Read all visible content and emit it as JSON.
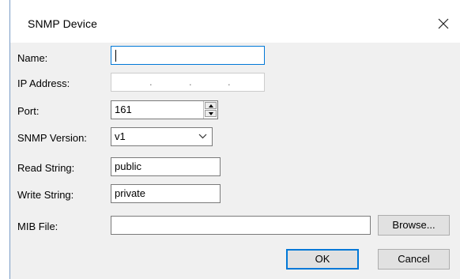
{
  "window": {
    "title": "SNMP Device",
    "close_glyph": "×"
  },
  "form": {
    "name": {
      "label": "Name:",
      "value": ""
    },
    "ip": {
      "label": "IP Address:",
      "dot1": ".",
      "dot2": ".",
      "dot3": "."
    },
    "port": {
      "label": "Port:",
      "value": "161"
    },
    "snmp_version": {
      "label": "SNMP Version:",
      "selected": "v1"
    },
    "read_string": {
      "label": "Read String:",
      "value": "public"
    },
    "write_string": {
      "label": "Write String:",
      "value": "private"
    },
    "mib_file": {
      "label": "MIB File:",
      "value": "",
      "browse_label": "Browse..."
    }
  },
  "buttons": {
    "ok_label": "OK",
    "cancel_label": "Cancel"
  },
  "icons": {
    "close": "close-icon",
    "spin_up": "chevron-up-icon",
    "spin_down": "chevron-down-icon",
    "dropdown": "chevron-down-icon"
  },
  "colors": {
    "focus_border": "#0078d7",
    "dialog_background": "#f0f0f0",
    "button_face": "#e1e1e1"
  }
}
